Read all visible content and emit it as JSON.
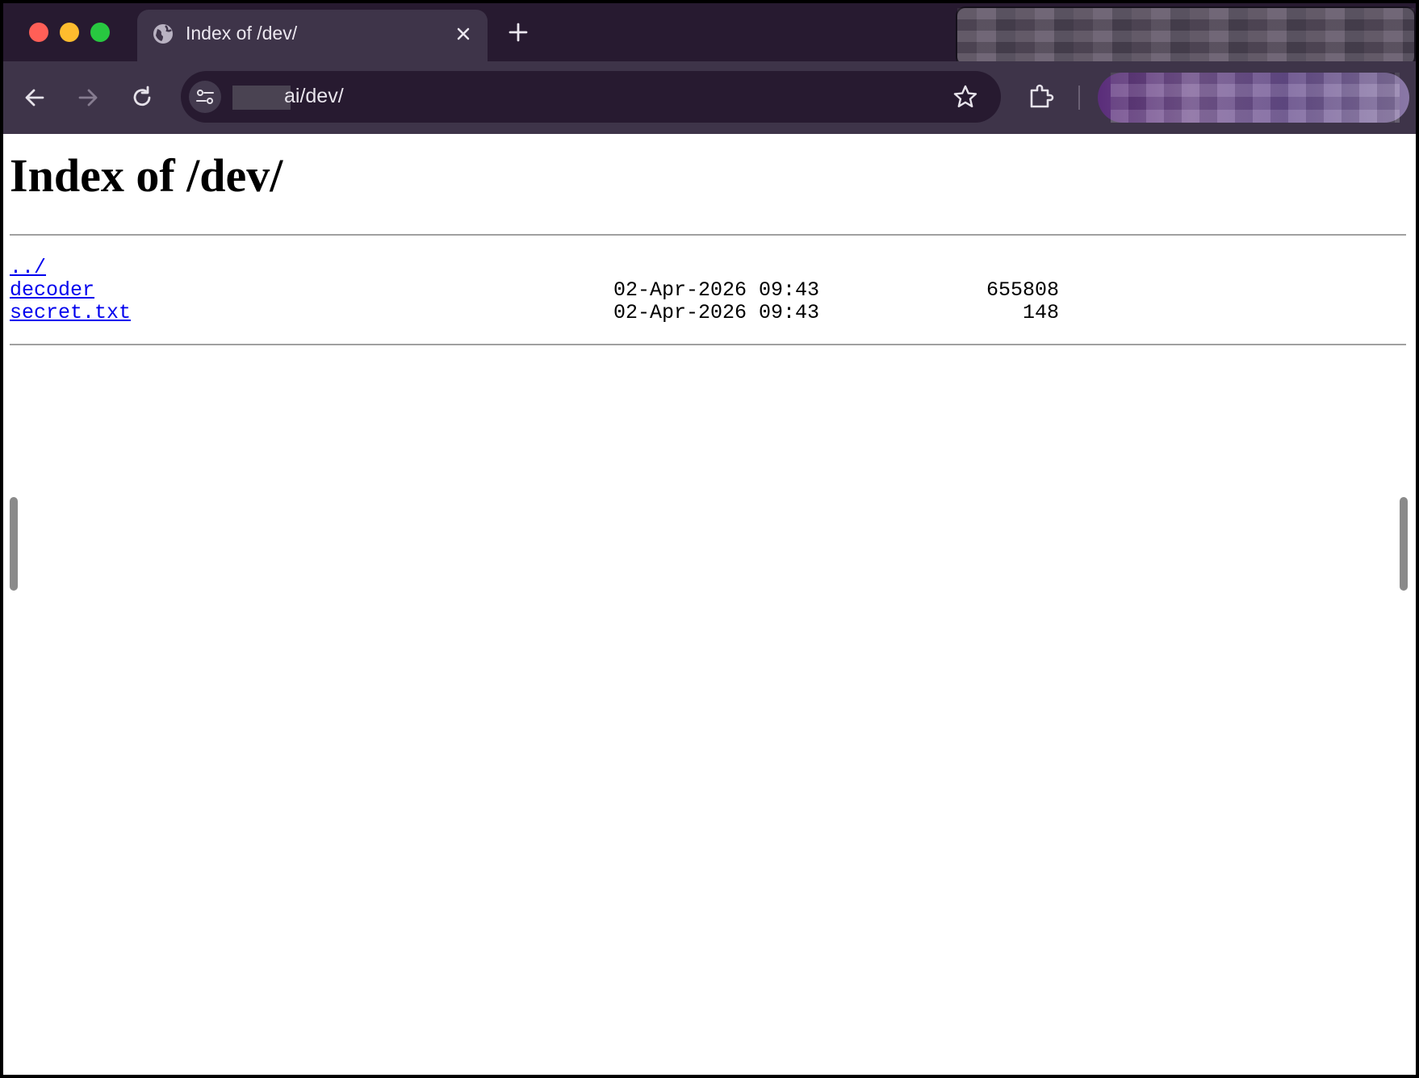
{
  "browser": {
    "tab_title": "Index of /dev/",
    "url_visible": "ai/dev/"
  },
  "page": {
    "heading": "Index of /dev/",
    "entries": [
      {
        "name": "../",
        "date": "",
        "size": ""
      },
      {
        "name": "decoder",
        "date": "02-Apr-2026 09:43",
        "size": "655808"
      },
      {
        "name": "secret.txt",
        "date": "02-Apr-2026 09:43",
        "size": "148"
      }
    ]
  },
  "colors": {
    "link": "#0000ee",
    "tabstrip": "#271a30",
    "toolbar": "#3e3449"
  },
  "icons": [
    "globe-icon",
    "close-icon",
    "plus-icon",
    "back-arrow-icon",
    "forward-arrow-icon",
    "reload-icon",
    "site-settings-icon",
    "star-icon",
    "extensions-icon"
  ]
}
